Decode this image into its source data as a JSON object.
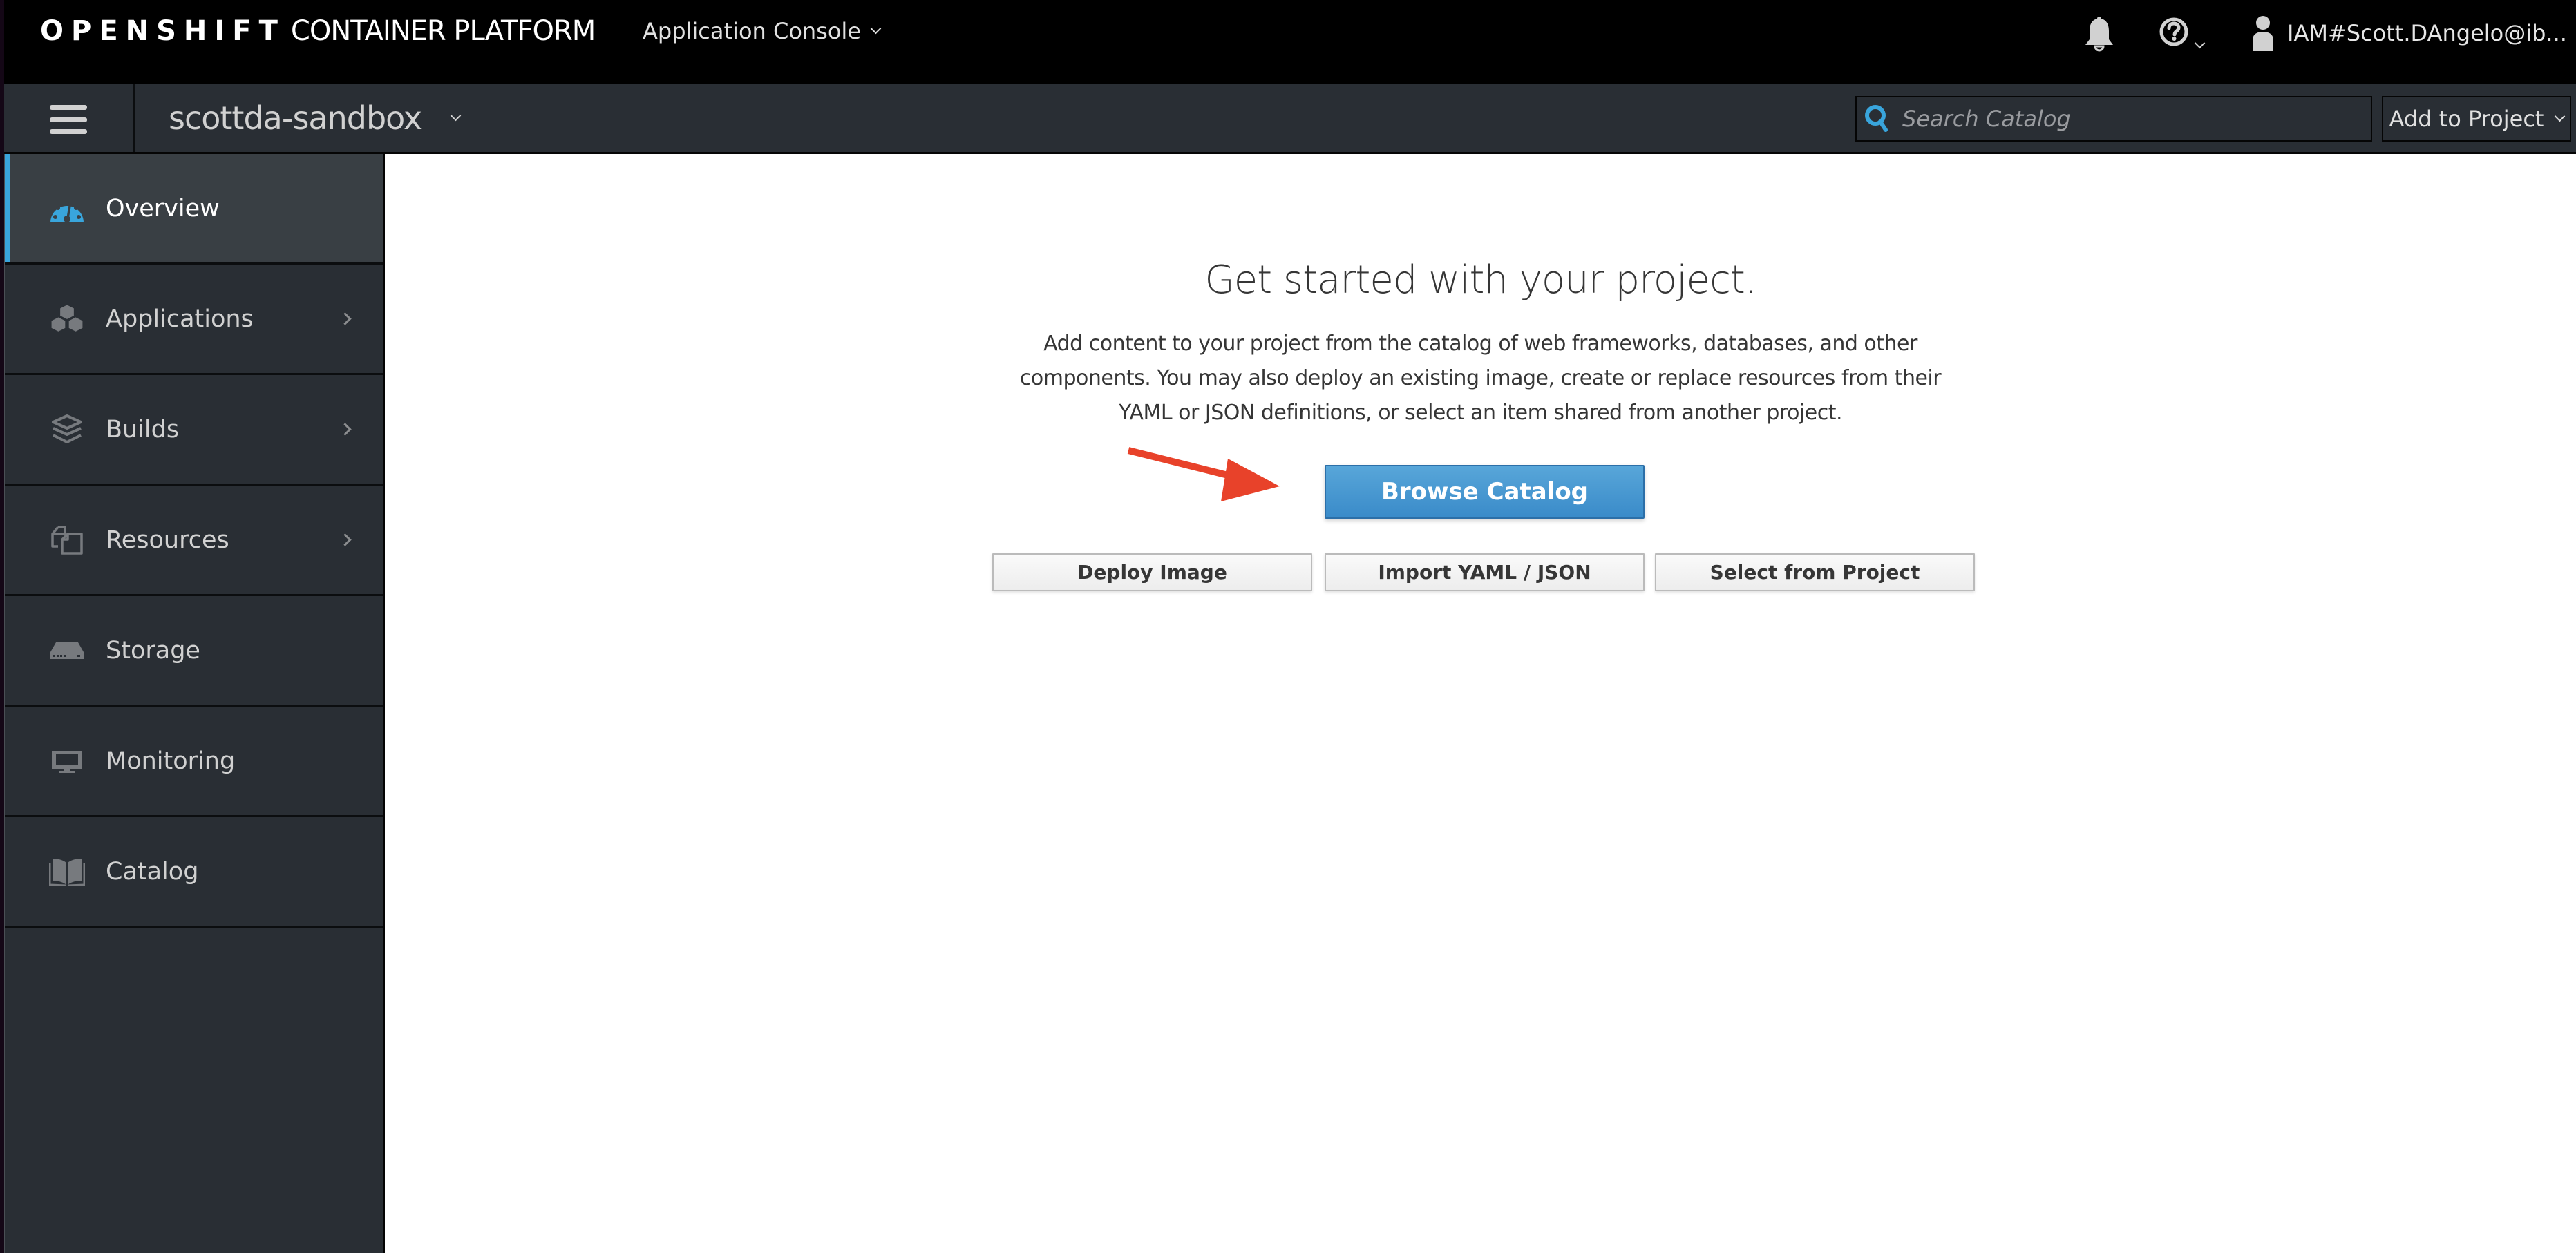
{
  "header": {
    "brand_bold": "OPENSHIFT",
    "brand_light": "CONTAINER PLATFORM",
    "console_switcher": "Application Console",
    "notifications_icon": "bell-icon",
    "help_icon": "question-circle-icon",
    "user_icon": "user-icon",
    "username": "IAM#Scott.DAngelo@ib..."
  },
  "project_bar": {
    "menu_icon": "hamburger-icon",
    "project_name": "scottda-sandbox",
    "search_placeholder": "Search Catalog",
    "search_value": "",
    "add_to_project": "Add to Project"
  },
  "sidebar": {
    "items": [
      {
        "label": "Overview",
        "icon": "dashboard-icon",
        "active": true,
        "has_submenu": false
      },
      {
        "label": "Applications",
        "icon": "cubes-icon",
        "active": false,
        "has_submenu": true
      },
      {
        "label": "Builds",
        "icon": "layers-icon",
        "active": false,
        "has_submenu": true
      },
      {
        "label": "Resources",
        "icon": "copy-icon",
        "active": false,
        "has_submenu": true
      },
      {
        "label": "Storage",
        "icon": "storage-icon",
        "active": false,
        "has_submenu": false
      },
      {
        "label": "Monitoring",
        "icon": "monitor-icon",
        "active": false,
        "has_submenu": false
      },
      {
        "label": "Catalog",
        "icon": "book-icon",
        "active": false,
        "has_submenu": false
      }
    ]
  },
  "main": {
    "title": "Get started with your project.",
    "description": "Add content to your project from the catalog of web frameworks, databases, and other components. You may also deploy an existing image, create or replace resources from their YAML or JSON definitions, or select an item shared from another project.",
    "primary_button": "Browse Catalog",
    "secondary_buttons": [
      "Deploy Image",
      "Import YAML / JSON",
      "Select from Project"
    ]
  },
  "annotation": {
    "type": "arrow",
    "points_to": "Browse Catalog",
    "color": "#e8422a"
  },
  "colors": {
    "header_bg": "#000000",
    "bar_bg": "#292e34",
    "active_item_bg": "#393f44",
    "accent": "#39a5dc",
    "primary_button": "#3f9bd6"
  }
}
